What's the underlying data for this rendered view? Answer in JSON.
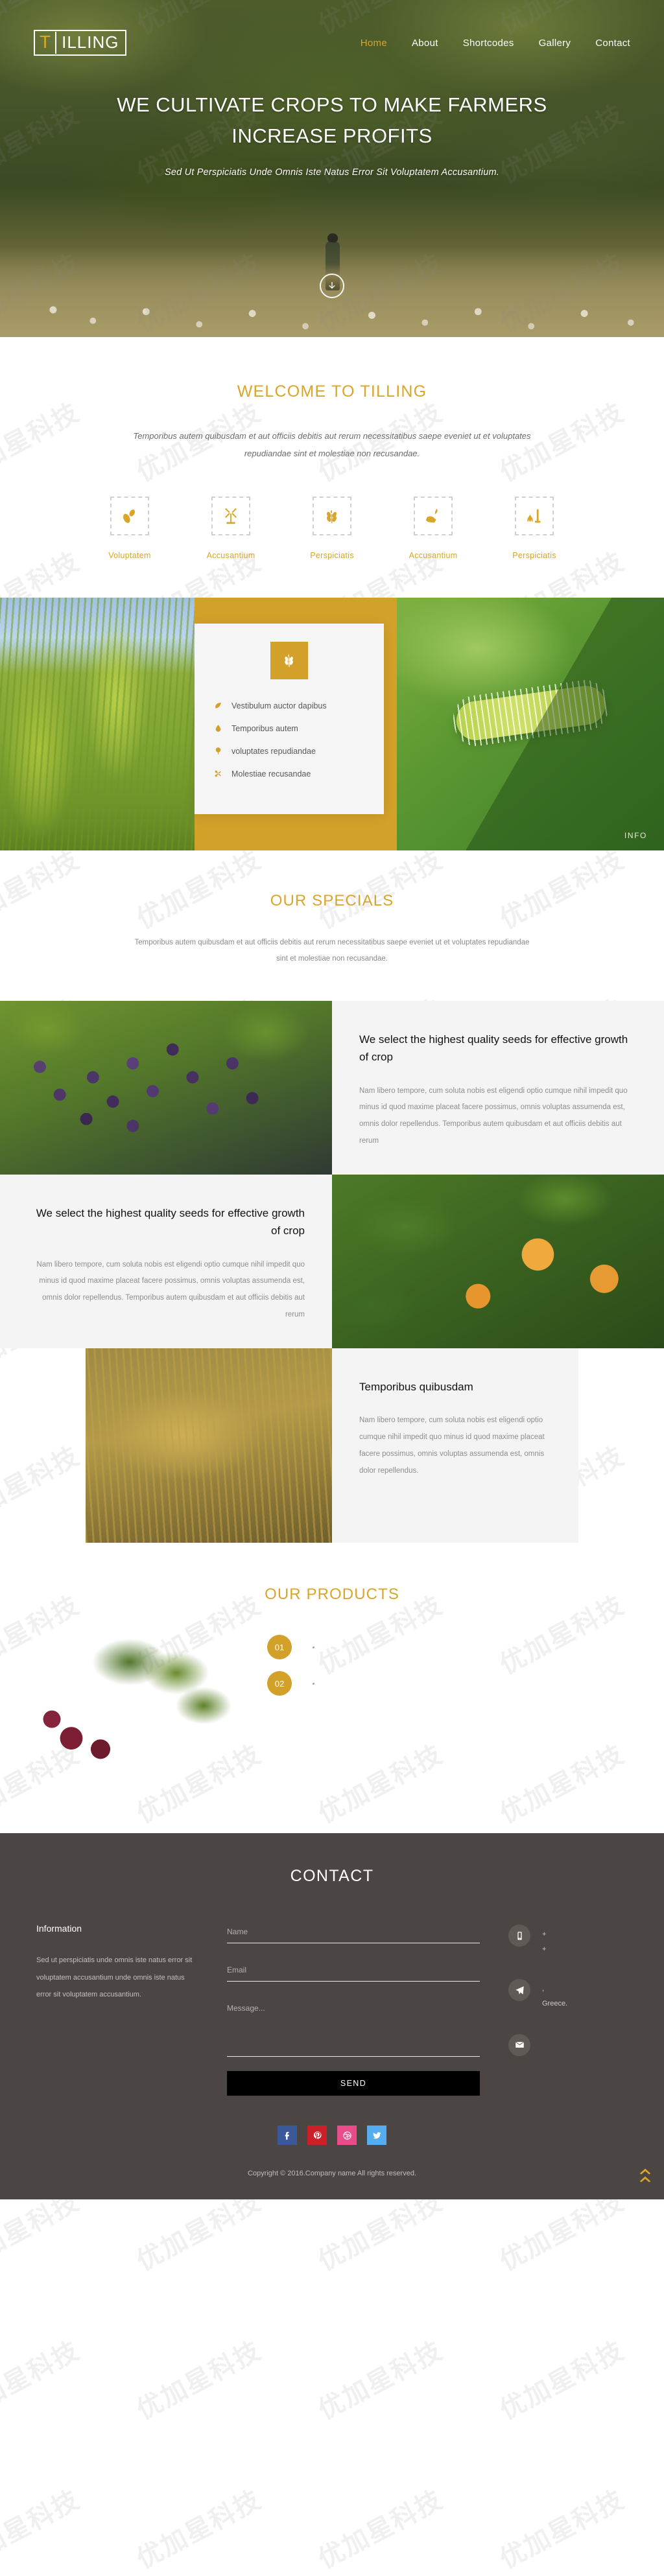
{
  "header": {
    "logo_accent": "T",
    "logo_rest": "ILLING",
    "nav": [
      {
        "label": "Home",
        "active": true
      },
      {
        "label": "About",
        "active": false
      },
      {
        "label": "Shortcodes",
        "active": false
      },
      {
        "label": "Gallery",
        "active": false
      },
      {
        "label": "Contact",
        "active": false
      }
    ]
  },
  "hero": {
    "title_line1": "WE CULTIVATE CROPS TO MAKE FARMERS",
    "title_line2": "INCREASE PROFITS",
    "subtitle": "Sed Ut Perspiciatis Unde Omnis Iste Natus Error Sit Voluptatem Accusantium.",
    "scroll_icon": "arrow-down-icon"
  },
  "welcome": {
    "title": "WELCOME TO TILLING",
    "lead": "Temporibus autem quibusdam et aut officiis debitis aut rerum necessitatibus saepe eveniet ut et voluptates repudiandae sint et molestiae non recusandae.",
    "features": [
      {
        "label": "Voluptatem",
        "icon": "seeds-icon"
      },
      {
        "label": "Accusantium",
        "icon": "windmill-icon"
      },
      {
        "label": "Perspiciatis",
        "icon": "wheat-icon"
      },
      {
        "label": "Accusantium",
        "icon": "hand-seed-icon"
      },
      {
        "label": "Perspiciatis",
        "icon": "planting-icon"
      }
    ]
  },
  "band": {
    "card_icon": "wheat-badge-icon",
    "list": [
      {
        "label": "Vestibulum auctor dapibus",
        "icon": "leaf-icon"
      },
      {
        "label": "Temporibus autem",
        "icon": "droplet-icon"
      },
      {
        "label": "voluptates repudiandae",
        "icon": "tree-icon"
      },
      {
        "label": "Molestiae recusandae",
        "icon": "scissors-icon"
      }
    ],
    "info_tag": "INFO"
  },
  "specials": {
    "title": "OUR SPECIALS",
    "subtitle": "Temporibus autem quibusdam et aut officiis debitis aut rerum necessitatibus saepe eveniet ut et voluptates repudiandae sint et molestiae non recusandae.",
    "blocks": [
      {
        "heading": "We select the highest quality seeds for effective growth of crop",
        "body": "Nam libero tempore, cum soluta nobis est eligendi optio cumque nihil impedit quo minus id quod maxime placeat facere possimus, omnis voluptas assumenda est, omnis dolor repellendus. Temporibus autem quibusdam et aut officiis debitis aut rerum",
        "image": "grapes-photo"
      },
      {
        "heading": "We select the highest quality seeds for effective growth of crop",
        "body": "Nam libero tempore, cum soluta nobis est eligendi optio cumque nihil impedit quo minus id quod maxime placeat facere possimus, omnis voluptas assumenda est, omnis dolor repellendus. Temporibus autem quibusdam et aut officiis debitis aut rerum",
        "image": "peach-photo"
      },
      {
        "heading": "Temporibus quibusdam",
        "body": "Nam libero tempore, cum soluta nobis est eligendi optio cumque nihil impedit quo minus id quod maxime placeat facere possimus, omnis voluptas assumenda est, omnis dolor repellendus.",
        "image": "wheat-photo"
      }
    ]
  },
  "products": {
    "title": "OUR PRODUCTS",
    "image": "beetroot-photo",
    "items": [
      {
        "number": "01"
      },
      {
        "number": "02"
      }
    ]
  },
  "contact": {
    "title": "CONTACT",
    "information_heading": "Information",
    "information_body": "Sed ut perspiciatis unde omnis iste natus error sit voluptatem accusantium unde omnis iste natus error sit voluptatem accusantium.",
    "form": {
      "name_placeholder": "Name",
      "email_placeholder": "Email",
      "message_placeholder": "Message...",
      "name_value": "",
      "email_value": "",
      "message_value": "",
      "send_label": "SEND"
    },
    "details": [
      {
        "icon": "mobile-icon",
        "line1": "+",
        "line2": "+"
      },
      {
        "icon": "paper-plane-icon",
        "line1": ",",
        "line2": "Greece."
      },
      {
        "icon": "envelope-icon",
        "line1": "",
        "line2": ""
      }
    ],
    "social": [
      {
        "name": "facebook",
        "color": "#3b5998",
        "glyph": "f"
      },
      {
        "name": "pinterest",
        "color": "#cb2027",
        "glyph": "p"
      },
      {
        "name": "dribbble",
        "color": "#ea4c89",
        "glyph": "d"
      },
      {
        "name": "twitter",
        "color": "#55acee",
        "glyph": "t"
      }
    ],
    "copyright": "Copyright © 2016.Company name All rights reserved.",
    "to_top_icon": "double-chevron-up-icon"
  },
  "watermark": {
    "text": "优加星科技"
  },
  "colors": {
    "accent": "#d9a52a",
    "band_gold": "#d3a02a",
    "contact_bg": "#4b4644"
  }
}
